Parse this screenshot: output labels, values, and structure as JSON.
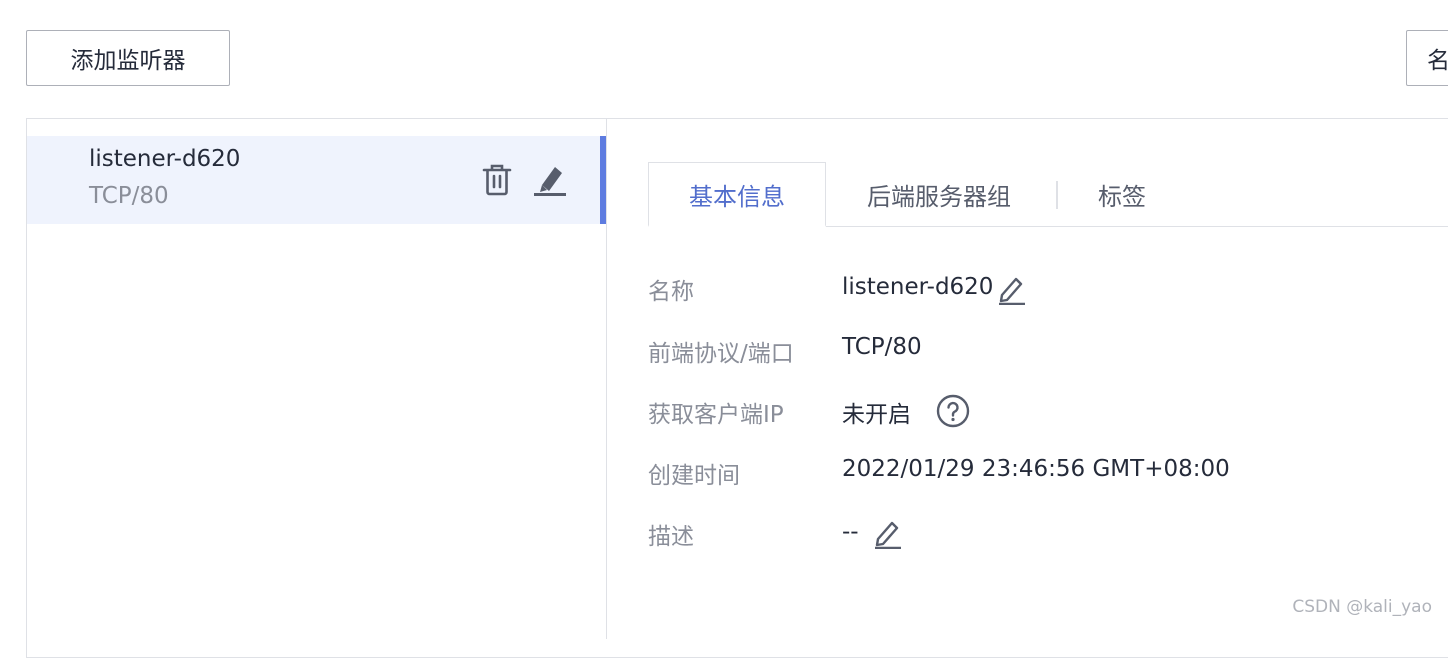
{
  "toolbar": {
    "add_listener_label": "添加监听器",
    "right_button_label": "名"
  },
  "listener_list": {
    "items": [
      {
        "name": "listener-d620",
        "protocol": "TCP/80"
      }
    ]
  },
  "tabs": [
    {
      "label": "基本信息",
      "active": true
    },
    {
      "label": "后端服务器组",
      "active": false
    },
    {
      "label": "标签",
      "active": false
    }
  ],
  "details": {
    "name_label": "名称",
    "name_value": "listener-d620",
    "frontend_label": "前端协议/端口",
    "frontend_value": "TCP/80",
    "client_ip_label": "获取客户端IP",
    "client_ip_value": "未开启",
    "created_label": "创建时间",
    "created_value": "2022/01/29 23:46:56 GMT+08:00",
    "description_label": "描述",
    "description_value": "--"
  },
  "icons": {
    "delete": "trash-icon",
    "edit": "pencil-icon",
    "help": "question-circle-icon"
  },
  "colors": {
    "accent": "#5e7ce0",
    "active_tab": "#526ecc",
    "selected_bg": "#eff3fd",
    "label": "#8a8e99",
    "text": "#252b3a"
  },
  "watermark": "CSDN @kali_yao"
}
